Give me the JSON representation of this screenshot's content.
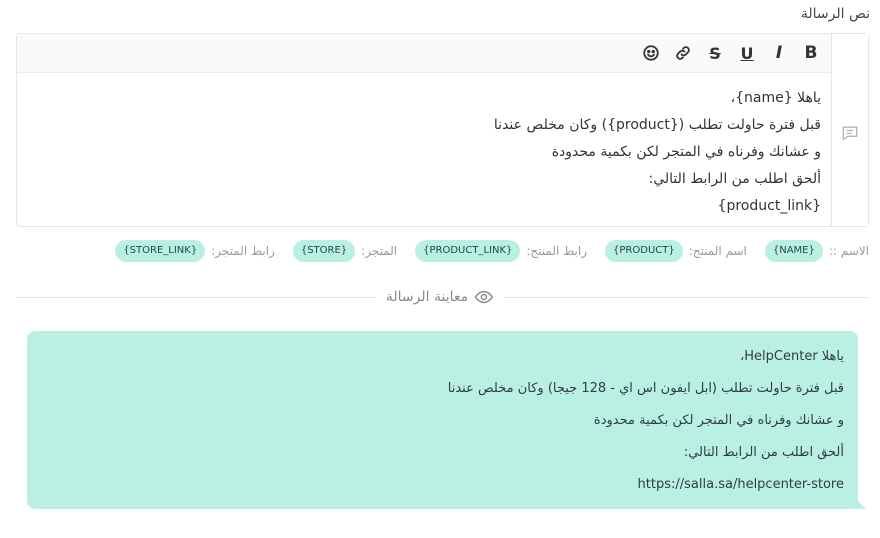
{
  "field_label": "نص الرسالة",
  "toolbar": {
    "bold": "B",
    "italic": "I",
    "underline": "U",
    "strike": "S"
  },
  "editor": {
    "lines": [
      "ياهلا {name}،",
      "قبل فترة حاولت تطلب ({product}) وكان مخلص عندنا",
      "و عشانك وفرناه في المتجر لكن بكمية محدودة",
      "ألحق اطلب من الرابط التالي:",
      "{product_link}"
    ]
  },
  "variables": {
    "name_label": "الاسم ::",
    "name_chip": "{NAME}",
    "product_label": "اسم المنتج:",
    "product_chip": "{PRODUCT}",
    "product_link_label": "رابط المنتج:",
    "product_link_chip": "{PRODUCT_LINK}",
    "store_label": "المتجر:",
    "store_chip": "{STORE}",
    "store_link_label": "رابط المتجر:",
    "store_link_chip": "{STORE_LINK}"
  },
  "preview": {
    "title": "معاينة الرسالة",
    "lines": [
      "ياهلا HelpCenter،",
      "قبل فترة حاولت تطلب (ابل ايفون اس اي - 128 جيجا) وكان مخلص عندنا",
      "و عشانك وفرناه في المتجر لكن بكمية محدودة",
      "ألحق اطلب من الرابط التالي:",
      "https://salla.sa/helpcenter-store"
    ]
  },
  "colors": {
    "chip_bg": "#baf0e3",
    "bubble_bg": "#baf0e3",
    "border": "#e6e6e6"
  }
}
